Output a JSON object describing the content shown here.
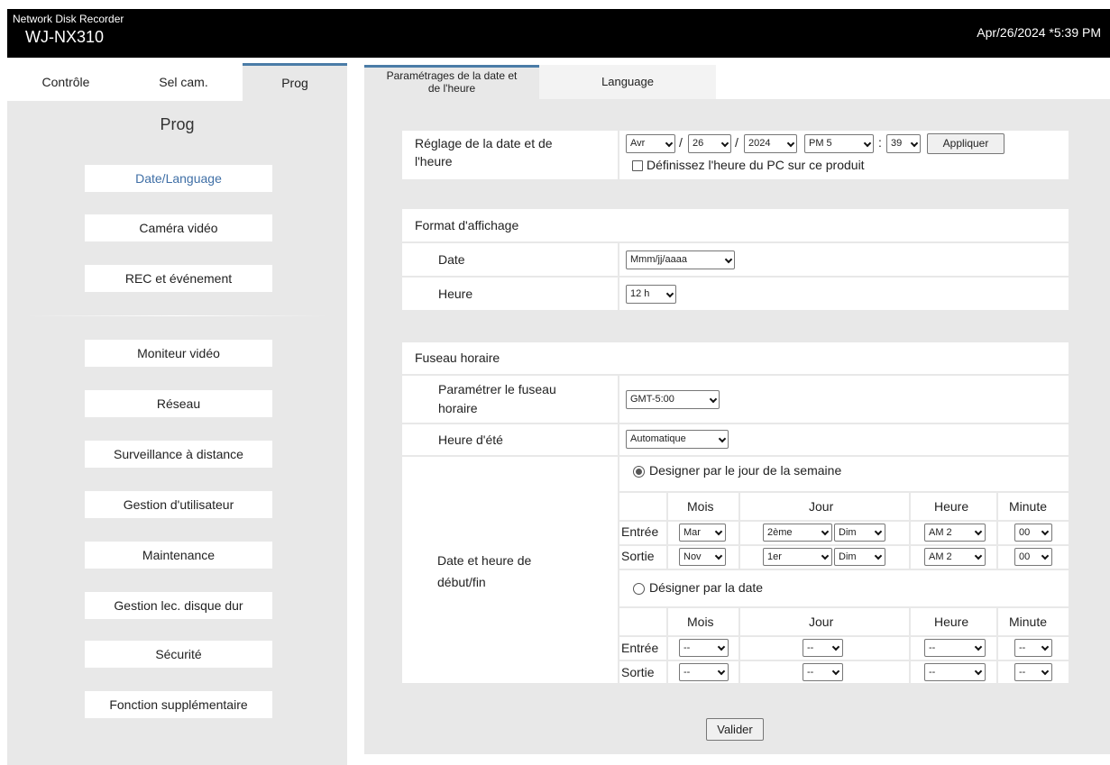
{
  "header": {
    "product_line": "Network Disk Recorder",
    "model": "WJ-NX310",
    "datetime": "Apr/26/2024 *5:39 PM"
  },
  "left_tabs": [
    "Contrôle",
    "Sel cam.",
    "Prog"
  ],
  "left_panel": {
    "title": "Prog",
    "menu": [
      "Date/Language",
      "Caméra vidéo",
      "REC et événement",
      "Moniteur vidéo",
      "Réseau",
      "Surveillance à distance",
      "Gestion d'utilisateur",
      "Maintenance",
      "Gestion lec. disque dur",
      "Sécurité",
      "Fonction supplémentaire"
    ]
  },
  "right_tabs": {
    "active_line1": "Paramétrages de la date et",
    "active_line2": "de l'heure",
    "language": "Language"
  },
  "datetime_setting": {
    "label_line1": "Réglage de la date et de",
    "label_line2": "l'heure",
    "month": "Avr",
    "sep1": "/",
    "day": "26",
    "sep2": "/",
    "year": "2024",
    "hour": "PM 5",
    "colon": ":",
    "minute": "39",
    "apply": "Appliquer",
    "pc_time_label": "Définissez l'heure du PC sur ce produit"
  },
  "display_format": {
    "heading": "Format d'affichage",
    "date_label": "Date",
    "date_value": "Mmm/jj/aaaa",
    "time_label": "Heure",
    "time_value": "12 h"
  },
  "timezone": {
    "heading": "Fuseau horaire",
    "tz_label_line1": "Paramétrer le fuseau",
    "tz_label_line2": "horaire",
    "tz_value": "GMT-5:00",
    "dst_label": "Heure d'été",
    "dst_value": "Automatique",
    "startend_label_line1": "Date et heure de",
    "startend_label_line2": "début/fin",
    "by_weekday": {
      "label": "Designer par le jour de la semaine",
      "selected": true,
      "headers": [
        "Mois",
        "Jour",
        "Heure",
        "Minute"
      ],
      "rows": [
        {
          "name": "Entrée",
          "month": "Mar",
          "week": "2ème",
          "weekday": "Dim",
          "hour": "AM 2",
          "minute": "00"
        },
        {
          "name": "Sortie",
          "month": "Nov",
          "week": "1er",
          "weekday": "Dim",
          "hour": "AM 2",
          "minute": "00"
        }
      ]
    },
    "by_date": {
      "label": "Désigner par la date",
      "selected": false,
      "headers": [
        "Mois",
        "Jour",
        "Heure",
        "Minute"
      ],
      "rows": [
        {
          "name": "Entrée",
          "month": "--",
          "day": "--",
          "hour": "--",
          "minute": "--"
        },
        {
          "name": "Sortie",
          "month": "--",
          "day": "--",
          "hour": "--",
          "minute": "--"
        }
      ]
    }
  },
  "footer": {
    "submit": "Valider"
  }
}
